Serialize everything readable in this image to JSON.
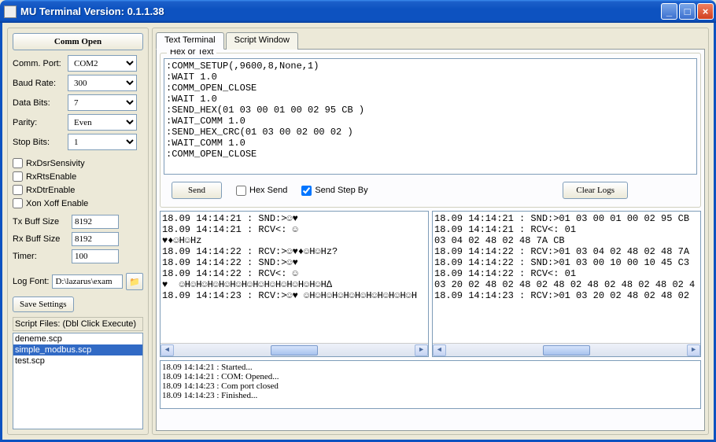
{
  "window": {
    "title": "MU Terminal Version: 0.1.1.38"
  },
  "left": {
    "comm_open": "Comm Open",
    "comm_port_label": "Comm. Port:",
    "comm_port": "COM2",
    "baud_label": "Baud Rate:",
    "baud": "300",
    "databits_label": "Data Bits:",
    "databits": "7",
    "parity_label": "Parity:",
    "parity": "Even",
    "stopbits_label": "Stop Bits:",
    "stopbits": "1",
    "cb_rxdsr": "RxDsrSensivity",
    "cb_rxrts": "RxRtsEnable",
    "cb_rxdtr": "RxDtrEnable",
    "cb_xon": "Xon Xoff Enable",
    "txbuff_label": "Tx Buff Size",
    "txbuff": "8192",
    "rxbuff_label": "Rx Buff Size",
    "rxbuff": "8192",
    "timer_label": "Timer:",
    "timer": "100",
    "logfont_label": "Log Font:",
    "logfont": "D:\\lazarus\\exam",
    "save_settings": "Save Settings",
    "script_label": "Script Files: (Dbl Click Execute)",
    "scripts": [
      "deneme.scp",
      "simple_modbus.scp",
      "test.scp"
    ],
    "script_selected": 1
  },
  "tabs": {
    "text_terminal": "Text Terminal",
    "script_window": "Script Window"
  },
  "hex": {
    "group_title": "Hex or Text",
    "content": ":COMM_SETUP(,9600,8,None,1)\n:WAIT 1.0\n:COMM_OPEN_CLOSE\n:WAIT 1.0\n:SEND_HEX(01 03 00 01 00 02 95 CB )\n:WAIT_COMM 1.0\n:SEND_HEX_CRC(01 03 00 02 00 02 )\n:WAIT_COMM 1.0\n:COMM_OPEN_CLOSE"
  },
  "buttons": {
    "send": "Send",
    "hex_send": "Hex Send",
    "send_step": "Send Step By",
    "clear_logs": "Clear Logs"
  },
  "checks": {
    "hex_send": false,
    "send_step": true
  },
  "log_left": "18.09 14:14:21 : SND:>☺♥\n18.09 14:14:21 : RCV<: ☺\n♥♦☺H☺Hz\n18.09 14:14:22 : RCV:>☺♥♦☺H☺Hz?\n18.09 14:14:22 : SND:>☺♥\n18.09 14:14:22 : RCV<: ☺\n♥  ☺H☺H☺H☺H☺H☺H☺H☺H☺H☺H☺H☺H☺H∆\n18.09 14:14:23 : RCV:>☺♥ ☺H☺H☺H☺H☺H☺H☺H☺H☺H☺H",
  "log_right": "18.09 14:14:21 : SND:>01 03 00 01 00 02 95 CB\n18.09 14:14:21 : RCV<: 01\n03 04 02 48 02 48 7A CB\n18.09 14:14:22 : RCV:>01 03 04 02 48 02 48 7A\n18.09 14:14:22 : SND:>01 03 00 10 00 10 45 C3\n18.09 14:14:22 : RCV<: 01\n03 20 02 48 02 48 02 48 02 48 02 48 02 48 02 4\n18.09 14:14:23 : RCV:>01 03 20 02 48 02 48 02",
  "status": [
    "18.09 14:14:21 : Started...",
    "18.09 14:14:21 : COM: Opened...",
    "18.09 14:14:23 : Com port closed",
    "18.09 14:14:23 : Finished..."
  ]
}
